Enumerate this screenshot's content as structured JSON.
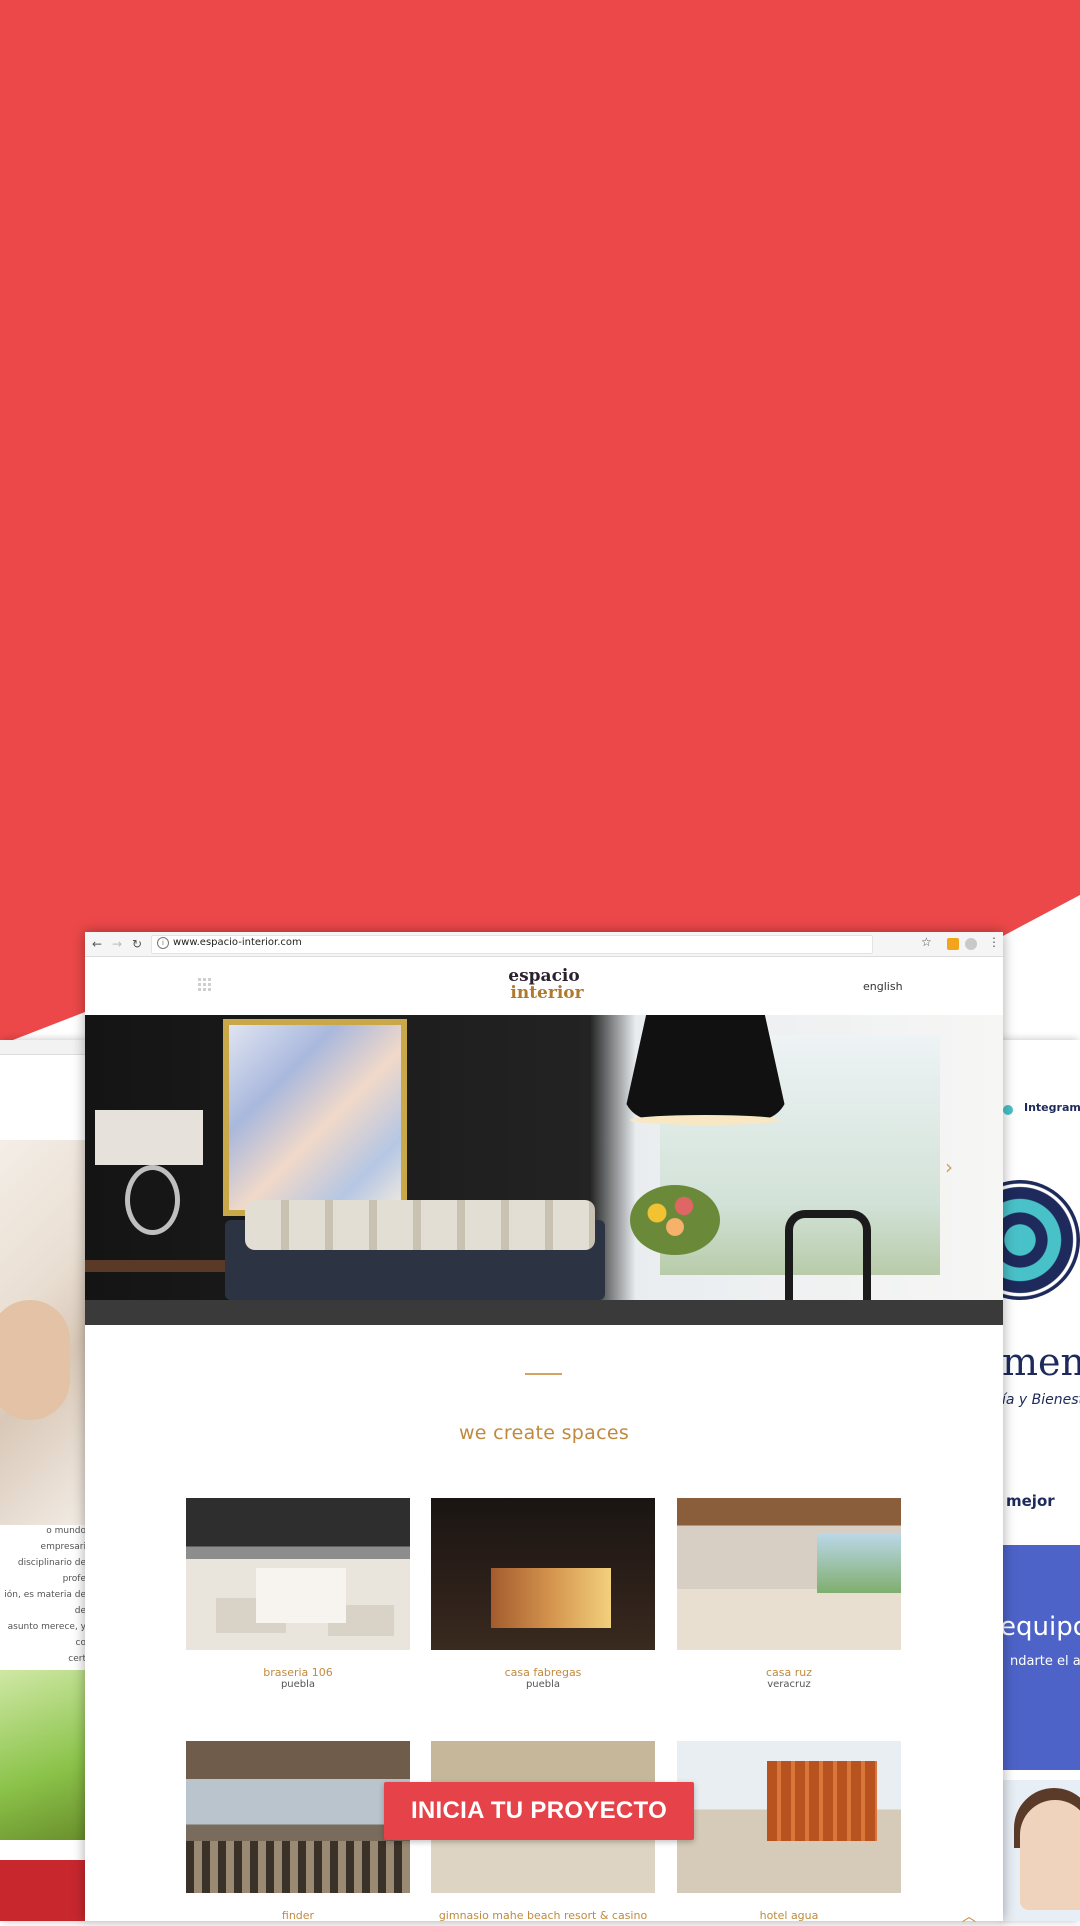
{
  "colors": {
    "background_red": "#ec4849",
    "accent_gold": "#c08a3e",
    "cta_red": "#e54349",
    "brand_navy": "#1d2a5b"
  },
  "browser": {
    "url": "www.espacio-interior.com",
    "icons": [
      "back-icon",
      "forward-icon",
      "reload-icon",
      "info-icon",
      "star-icon",
      "extension-icon",
      "menu-icon"
    ]
  },
  "site": {
    "logo_line1": "espacio",
    "logo_line2": "interior",
    "language": "english",
    "tagline": "we create spaces",
    "projects": [
      {
        "name": "braseria 106",
        "city": "puebla"
      },
      {
        "name": "casa fabregas",
        "city": "puebla"
      },
      {
        "name": "casa ruz",
        "city": "veracruz"
      },
      {
        "name": "finder",
        "city": ""
      },
      {
        "name": "gimnasio mahe beach resort & casino",
        "city": ""
      },
      {
        "name": "hotel agua",
        "city": ""
      }
    ]
  },
  "cta": {
    "label": "INICIA TU PROYECTO"
  },
  "side_left": {
    "text": "o mundo empresari\ndisciplinario de profe\nión, es materia de de\nasunto merece, y co\ncert"
  },
  "side_right": {
    "nav": "Integramo",
    "big": "ment",
    "sub": "ía y Bienesta",
    "mejor": "mejor",
    "equipo": "equipo",
    "andarte": "ndarte el a"
  }
}
